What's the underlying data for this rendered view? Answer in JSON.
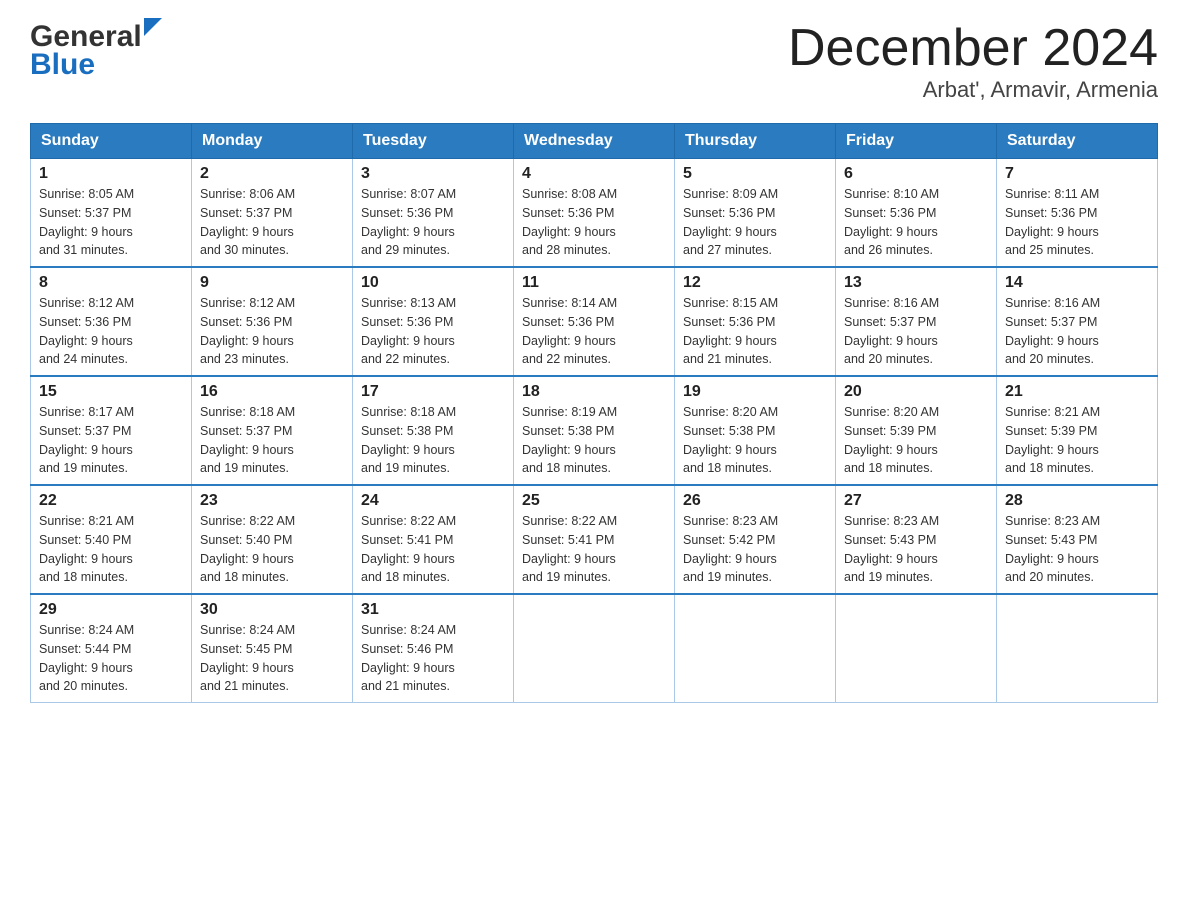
{
  "header": {
    "logo_general": "General",
    "logo_blue": "Blue",
    "month_title": "December 2024",
    "location": "Arbat', Armavir, Armenia"
  },
  "weekdays": [
    "Sunday",
    "Monday",
    "Tuesday",
    "Wednesday",
    "Thursday",
    "Friday",
    "Saturday"
  ],
  "weeks": [
    [
      {
        "day": "1",
        "sunrise": "8:05 AM",
        "sunset": "5:37 PM",
        "daylight": "9 hours and 31 minutes."
      },
      {
        "day": "2",
        "sunrise": "8:06 AM",
        "sunset": "5:37 PM",
        "daylight": "9 hours and 30 minutes."
      },
      {
        "day": "3",
        "sunrise": "8:07 AM",
        "sunset": "5:36 PM",
        "daylight": "9 hours and 29 minutes."
      },
      {
        "day": "4",
        "sunrise": "8:08 AM",
        "sunset": "5:36 PM",
        "daylight": "9 hours and 28 minutes."
      },
      {
        "day": "5",
        "sunrise": "8:09 AM",
        "sunset": "5:36 PM",
        "daylight": "9 hours and 27 minutes."
      },
      {
        "day": "6",
        "sunrise": "8:10 AM",
        "sunset": "5:36 PM",
        "daylight": "9 hours and 26 minutes."
      },
      {
        "day": "7",
        "sunrise": "8:11 AM",
        "sunset": "5:36 PM",
        "daylight": "9 hours and 25 minutes."
      }
    ],
    [
      {
        "day": "8",
        "sunrise": "8:12 AM",
        "sunset": "5:36 PM",
        "daylight": "9 hours and 24 minutes."
      },
      {
        "day": "9",
        "sunrise": "8:12 AM",
        "sunset": "5:36 PM",
        "daylight": "9 hours and 23 minutes."
      },
      {
        "day": "10",
        "sunrise": "8:13 AM",
        "sunset": "5:36 PM",
        "daylight": "9 hours and 22 minutes."
      },
      {
        "day": "11",
        "sunrise": "8:14 AM",
        "sunset": "5:36 PM",
        "daylight": "9 hours and 22 minutes."
      },
      {
        "day": "12",
        "sunrise": "8:15 AM",
        "sunset": "5:36 PM",
        "daylight": "9 hours and 21 minutes."
      },
      {
        "day": "13",
        "sunrise": "8:16 AM",
        "sunset": "5:37 PM",
        "daylight": "9 hours and 20 minutes."
      },
      {
        "day": "14",
        "sunrise": "8:16 AM",
        "sunset": "5:37 PM",
        "daylight": "9 hours and 20 minutes."
      }
    ],
    [
      {
        "day": "15",
        "sunrise": "8:17 AM",
        "sunset": "5:37 PM",
        "daylight": "9 hours and 19 minutes."
      },
      {
        "day": "16",
        "sunrise": "8:18 AM",
        "sunset": "5:37 PM",
        "daylight": "9 hours and 19 minutes."
      },
      {
        "day": "17",
        "sunrise": "8:18 AM",
        "sunset": "5:38 PM",
        "daylight": "9 hours and 19 minutes."
      },
      {
        "day": "18",
        "sunrise": "8:19 AM",
        "sunset": "5:38 PM",
        "daylight": "9 hours and 18 minutes."
      },
      {
        "day": "19",
        "sunrise": "8:20 AM",
        "sunset": "5:38 PM",
        "daylight": "9 hours and 18 minutes."
      },
      {
        "day": "20",
        "sunrise": "8:20 AM",
        "sunset": "5:39 PM",
        "daylight": "9 hours and 18 minutes."
      },
      {
        "day": "21",
        "sunrise": "8:21 AM",
        "sunset": "5:39 PM",
        "daylight": "9 hours and 18 minutes."
      }
    ],
    [
      {
        "day": "22",
        "sunrise": "8:21 AM",
        "sunset": "5:40 PM",
        "daylight": "9 hours and 18 minutes."
      },
      {
        "day": "23",
        "sunrise": "8:22 AM",
        "sunset": "5:40 PM",
        "daylight": "9 hours and 18 minutes."
      },
      {
        "day": "24",
        "sunrise": "8:22 AM",
        "sunset": "5:41 PM",
        "daylight": "9 hours and 18 minutes."
      },
      {
        "day": "25",
        "sunrise": "8:22 AM",
        "sunset": "5:41 PM",
        "daylight": "9 hours and 19 minutes."
      },
      {
        "day": "26",
        "sunrise": "8:23 AM",
        "sunset": "5:42 PM",
        "daylight": "9 hours and 19 minutes."
      },
      {
        "day": "27",
        "sunrise": "8:23 AM",
        "sunset": "5:43 PM",
        "daylight": "9 hours and 19 minutes."
      },
      {
        "day": "28",
        "sunrise": "8:23 AM",
        "sunset": "5:43 PM",
        "daylight": "9 hours and 20 minutes."
      }
    ],
    [
      {
        "day": "29",
        "sunrise": "8:24 AM",
        "sunset": "5:44 PM",
        "daylight": "9 hours and 20 minutes."
      },
      {
        "day": "30",
        "sunrise": "8:24 AM",
        "sunset": "5:45 PM",
        "daylight": "9 hours and 21 minutes."
      },
      {
        "day": "31",
        "sunrise": "8:24 AM",
        "sunset": "5:46 PM",
        "daylight": "9 hours and 21 minutes."
      },
      null,
      null,
      null,
      null
    ]
  ],
  "labels": {
    "sunrise": "Sunrise:",
    "sunset": "Sunset:",
    "daylight": "Daylight:"
  }
}
